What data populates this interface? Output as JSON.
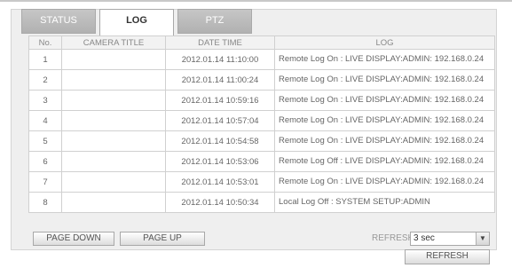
{
  "tabs": [
    {
      "label": "STATUS",
      "active": false
    },
    {
      "label": "LOG",
      "active": true
    },
    {
      "label": "PTZ",
      "active": false
    }
  ],
  "table": {
    "headers": [
      "No.",
      "CAMERA TITLE",
      "DATE TIME",
      "LOG"
    ],
    "rows": [
      {
        "no": "1",
        "camera": "",
        "datetime": "2012.01.14  11:10:00",
        "log": "Remote Log On : LIVE DISPLAY:ADMIN: 192.168.0.24"
      },
      {
        "no": "2",
        "camera": "",
        "datetime": "2012.01.14  11:00:24",
        "log": "Remote Log On : LIVE DISPLAY:ADMIN: 192.168.0.24"
      },
      {
        "no": "3",
        "camera": "",
        "datetime": "2012.01.14  10:59:16",
        "log": "Remote Log On : LIVE DISPLAY:ADMIN: 192.168.0.24"
      },
      {
        "no": "4",
        "camera": "",
        "datetime": "2012.01.14  10:57:04",
        "log": "Remote Log On : LIVE DISPLAY:ADMIN: 192.168.0.24"
      },
      {
        "no": "5",
        "camera": "",
        "datetime": "2012.01.14  10:54:58",
        "log": "Remote Log On : LIVE DISPLAY:ADMIN: 192.168.0.24"
      },
      {
        "no": "6",
        "camera": "",
        "datetime": "2012.01.14  10:53:06",
        "log": "Remote Log Off : LIVE DISPLAY:ADMIN: 192.168.0.24"
      },
      {
        "no": "7",
        "camera": "",
        "datetime": "2012.01.14  10:53:01",
        "log": "Remote Log On : LIVE DISPLAY:ADMIN: 192.168.0.24"
      },
      {
        "no": "8",
        "camera": "",
        "datetime": "2012.01.14  10:50:34",
        "log": "Local Log Off : SYSTEM SETUP:ADMIN"
      }
    ]
  },
  "controls": {
    "page_down_label": "PAGE DOWN",
    "page_up_label": "PAGE UP",
    "refresh_label": "REFRESH",
    "refresh_interval": "3 sec",
    "refresh_button_label": "REFRESH"
  }
}
